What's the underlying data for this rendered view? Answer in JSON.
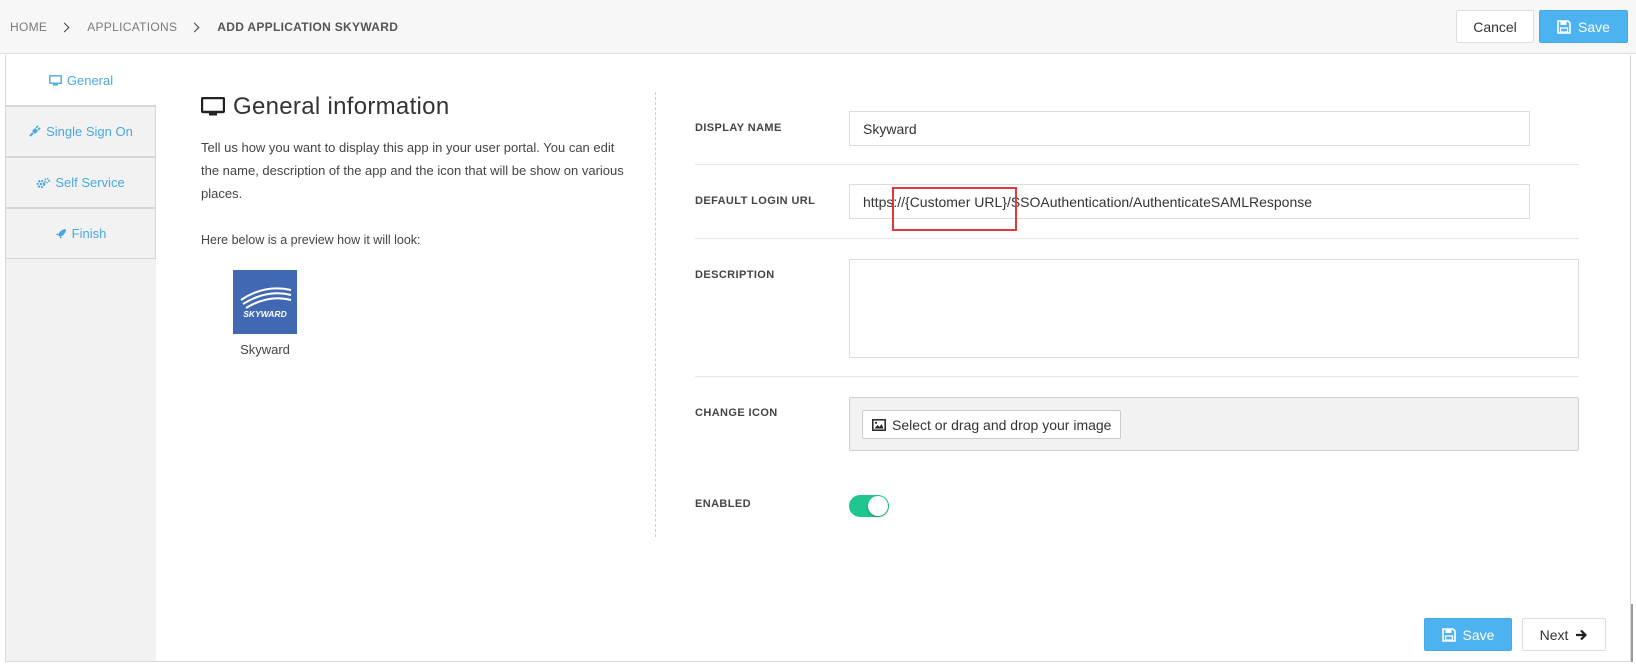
{
  "breadcrumb": {
    "items": [
      "HOME",
      "APPLICATIONS",
      "ADD APPLICATION SKYWARD"
    ]
  },
  "header": {
    "cancel_label": "Cancel",
    "save_label": "Save"
  },
  "tabs": [
    {
      "label": "General",
      "icon": "monitor-icon",
      "active": true
    },
    {
      "label": "Single Sign On",
      "icon": "plug-icon",
      "active": false
    },
    {
      "label": "Self Service",
      "icon": "cogs-icon",
      "active": false
    },
    {
      "label": "Finish",
      "icon": "rocket-icon",
      "active": false
    }
  ],
  "general": {
    "title": "General information",
    "description": "Tell us how you want to display this app in your user portal. You can edit the name, description of the app and the icon that will be show on various places.",
    "preview_label": "Here below is a preview how it will look:",
    "app_logo_text": "SKYWARD",
    "app_name": "Skyward"
  },
  "form": {
    "display_name": {
      "label": "DISPLAY NAME",
      "value": "Skyward"
    },
    "default_login_url": {
      "label": "DEFAULT LOGIN URL",
      "value": "https://{Customer URL}/SSOAuthentication/AuthenticateSAMLResponse"
    },
    "description": {
      "label": "DESCRIPTION",
      "value": ""
    },
    "change_icon": {
      "label": "CHANGE ICON",
      "button_label": "Select or drag and drop your image"
    },
    "enabled": {
      "label": "ENABLED",
      "value": true
    }
  },
  "footer": {
    "save_label": "Save",
    "next_label": "Next"
  },
  "colors": {
    "accent": "#4db2f0",
    "tab_text": "#4aa8e0",
    "toggle_on": "#1fc690",
    "highlight": "#e0393b",
    "app_tile": "#4169b3"
  }
}
